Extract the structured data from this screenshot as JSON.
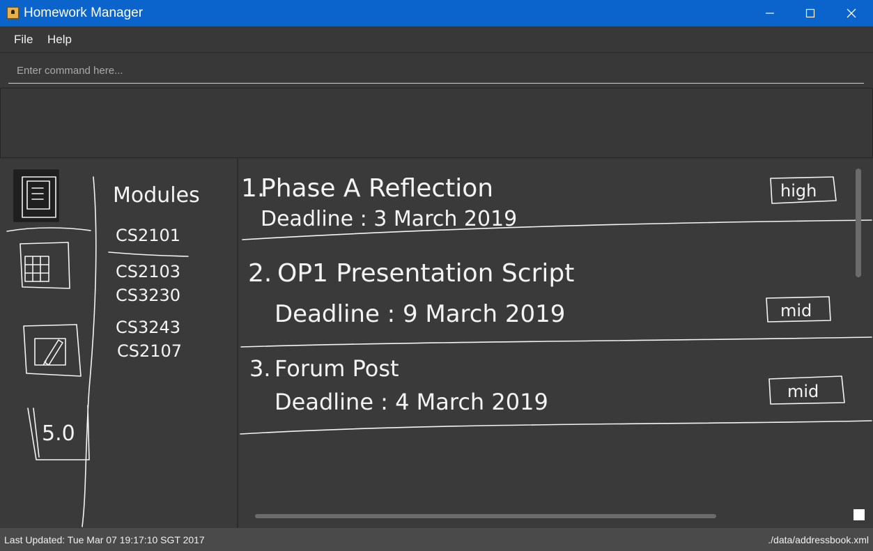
{
  "window": {
    "title": "Homework Manager",
    "controls": [
      "minimize",
      "maximize",
      "close"
    ]
  },
  "menu": {
    "items": [
      "File",
      "Help"
    ]
  },
  "command": {
    "placeholder": "Enter command here...",
    "value": ""
  },
  "sidebar": {
    "icons": [
      "list-icon",
      "calendar-icon",
      "edit-icon",
      "grade-icon"
    ],
    "grade_label": "5.0"
  },
  "modules": {
    "heading": "Modules",
    "items": [
      "CS2101",
      "CS2103",
      "CS3230",
      "CS3243",
      "CS2107"
    ]
  },
  "tasks": [
    {
      "number": "1.",
      "title": "Phase A Reflection",
      "deadline": "Deadline : 3 March 2019",
      "priority": "high"
    },
    {
      "number": "2.",
      "title": "OP1 Presentation Script",
      "deadline": "Deadline : 9 March 2019",
      "priority": "mid"
    },
    {
      "number": "3.",
      "title": "Forum Post",
      "deadline": "Deadline : 4 March 2019",
      "priority": "mid"
    }
  ],
  "status": {
    "last_updated": "Last Updated: Tue Mar 07 19:17:10 SGT 2017",
    "file_path": "./data/addressbook.xml"
  },
  "colors": {
    "titlebar": "#0a64cc",
    "background": "#383838",
    "sketch_ink": "#f4f4f4"
  }
}
